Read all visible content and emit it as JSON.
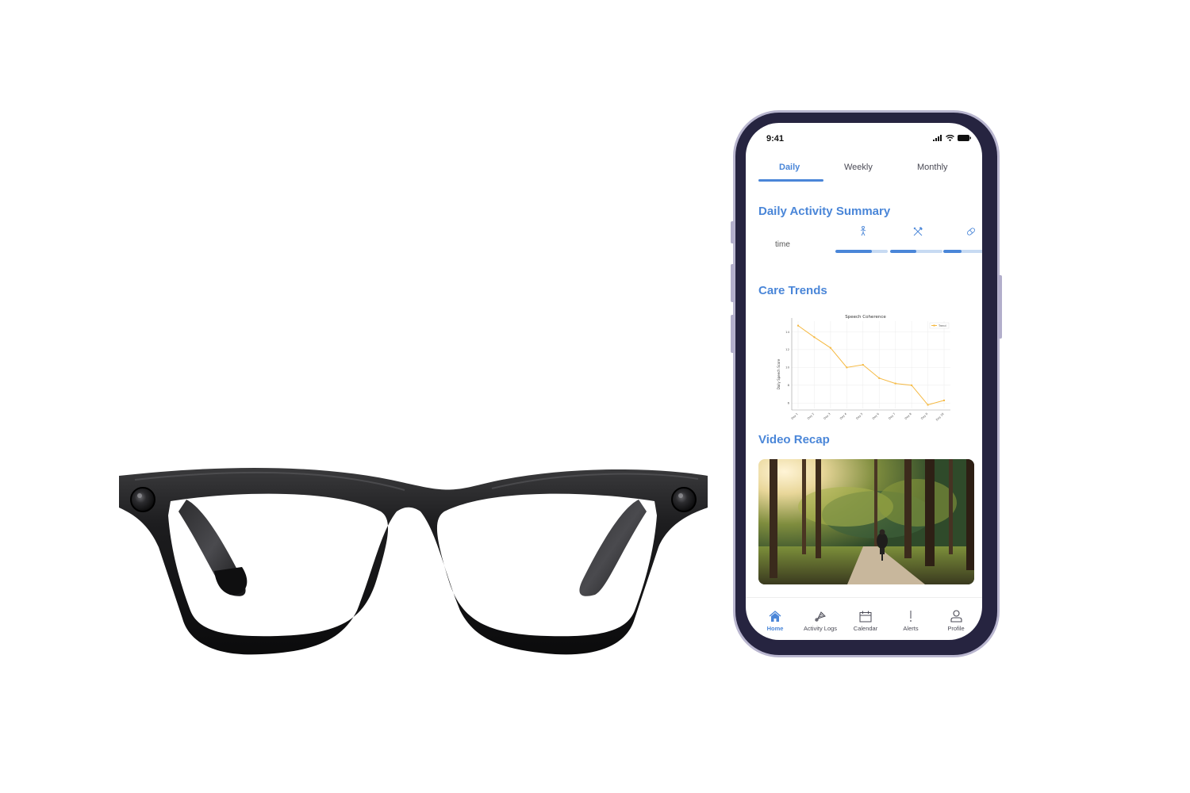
{
  "status_bar": {
    "time": "9:41",
    "icons": [
      "signal-icon",
      "wifi-icon",
      "battery-icon"
    ]
  },
  "tabs": [
    {
      "label": "Daily",
      "active": true
    },
    {
      "label": "Weekly",
      "active": false
    },
    {
      "label": "Monthly",
      "active": false
    }
  ],
  "daily_summary": {
    "title": "Daily Activity Summary",
    "row_label": "time",
    "activities": [
      {
        "icon": "walking-icon",
        "progress": 0.7
      },
      {
        "icon": "utensils-icon",
        "progress": 0.5
      },
      {
        "icon": "pill-icon",
        "progress": 0.35
      }
    ]
  },
  "care_trends": {
    "title": "Care Trends"
  },
  "chart_data": {
    "type": "line",
    "title": "Speech Coherence",
    "xlabel": "",
    "ylabel": "Daily Speech Score",
    "categories": [
      "Day 1",
      "Day 2",
      "Day 3",
      "Day 4",
      "Day 5",
      "Day 6",
      "Day 7",
      "Day 8",
      "Day 9",
      "Day 10"
    ],
    "series": [
      {
        "name": "Trend",
        "values": [
          14.7,
          13.4,
          12.2,
          10.0,
          10.3,
          8.8,
          8.2,
          8.0,
          5.8,
          6.3
        ],
        "color": "#f5b942"
      }
    ],
    "yticks": [
      6,
      8,
      10,
      12,
      14
    ],
    "ylim": [
      5.4,
      15.2
    ],
    "grid": true,
    "legend": "top-right"
  },
  "video_recap": {
    "title": "Video Recap",
    "thumbnail": "person cycling on a forest path in sunlight"
  },
  "navbar": [
    {
      "label": "Home",
      "icon": "home-icon",
      "active": true
    },
    {
      "label": "Activity Logs",
      "icon": "shuttlecock-icon",
      "active": false
    },
    {
      "label": "Calendar",
      "icon": "calendar-icon",
      "active": false
    },
    {
      "label": "Alerts",
      "icon": "alert-icon",
      "active": false
    },
    {
      "label": "Profile",
      "icon": "profile-icon",
      "active": false
    }
  ],
  "colors": {
    "accent": "#4a86d8",
    "accent_light": "#c7daf2",
    "phone_frame": "#262440",
    "phone_edge": "#b9b6cf",
    "chart_line": "#f5b942"
  }
}
